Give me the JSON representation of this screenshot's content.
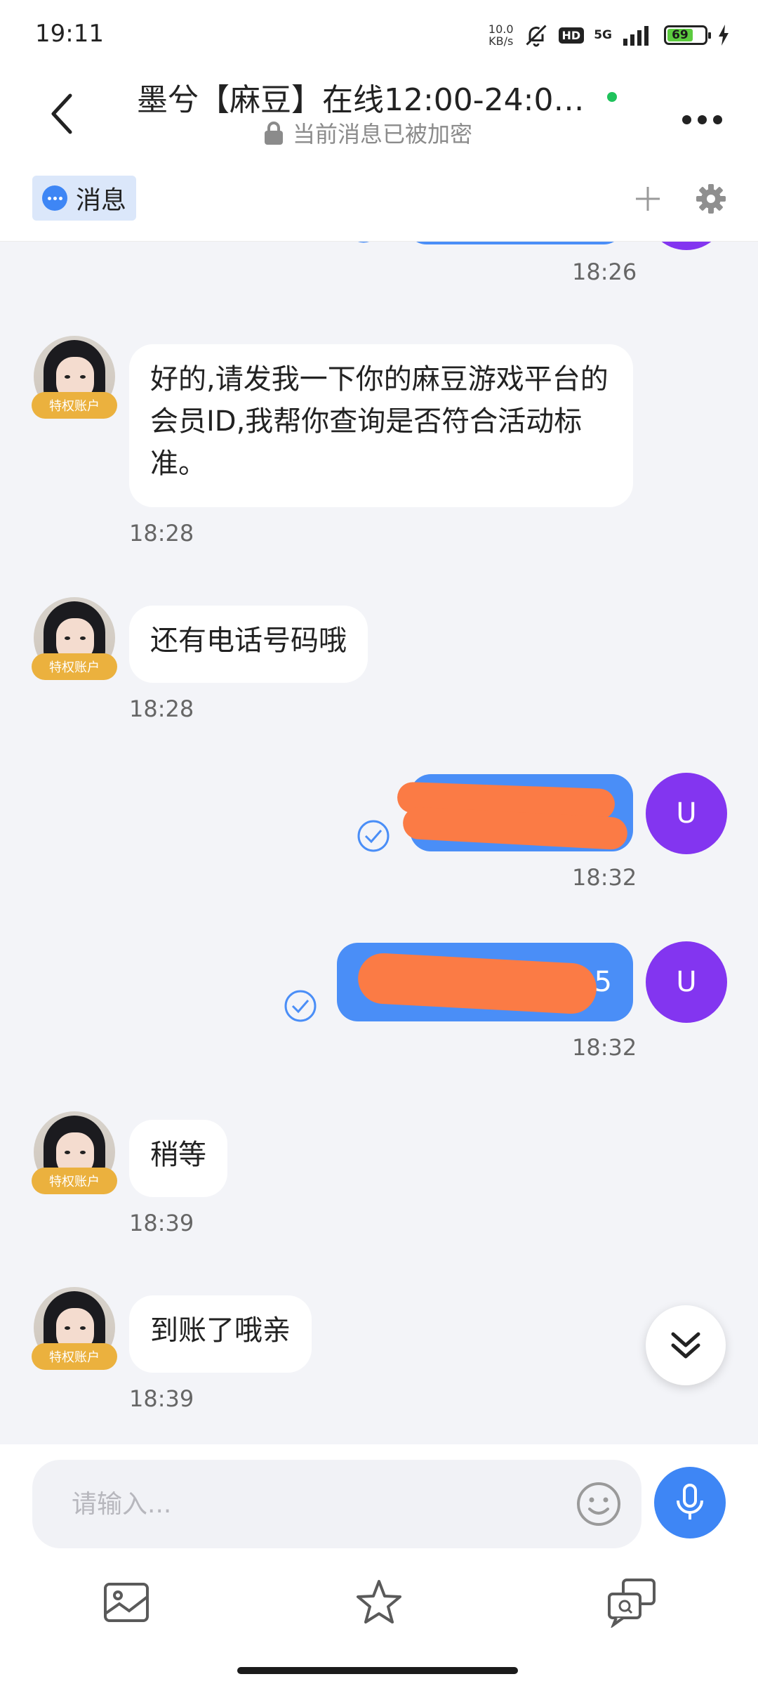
{
  "status_bar": {
    "time": "19:11",
    "net_speed_value": "10.0",
    "net_speed_unit": "KB/s",
    "hd": "HD",
    "network": "5G",
    "battery": "69",
    "icons": [
      "mute-bell-icon",
      "signal-icon",
      "battery-icon",
      "charging-icon"
    ]
  },
  "header": {
    "title": "墨兮【麻豆】在线12:00-24:00…",
    "subtitle": "当前消息已被加密",
    "online_color": "#1fc25b"
  },
  "tabs": {
    "messages_label": "消息"
  },
  "messages": [
    {
      "side": "in",
      "text": "",
      "time": "18:26",
      "partial": true
    },
    {
      "side": "in",
      "text": "好的,请发我一下你的麻豆游戏平台的会员ID,我帮你查询是否符合活动标准。",
      "time": "18:28",
      "badge": "特权账户"
    },
    {
      "side": "in",
      "text": "还有电话号码哦",
      "time": "18:28",
      "badge": "特权账户"
    },
    {
      "side": "out",
      "text": "",
      "time": "18:32",
      "avatar_letter": "U",
      "redacted": true
    },
    {
      "side": "out",
      "text": "5",
      "time": "18:32",
      "avatar_letter": "U",
      "redacted": true
    },
    {
      "side": "in",
      "text": "稍等",
      "time": "18:39",
      "badge": "特权账户"
    },
    {
      "side": "in",
      "text": "到账了哦亲",
      "time": "18:39",
      "badge": "特权账户"
    }
  ],
  "input": {
    "placeholder": "请输入..."
  },
  "colors": {
    "accent": "#3e86f5",
    "outgoing_bubble": "#4a8ef7",
    "user_avatar": "#8335f0",
    "badge": "#ebb13e",
    "redaction": "#fb7b45"
  }
}
